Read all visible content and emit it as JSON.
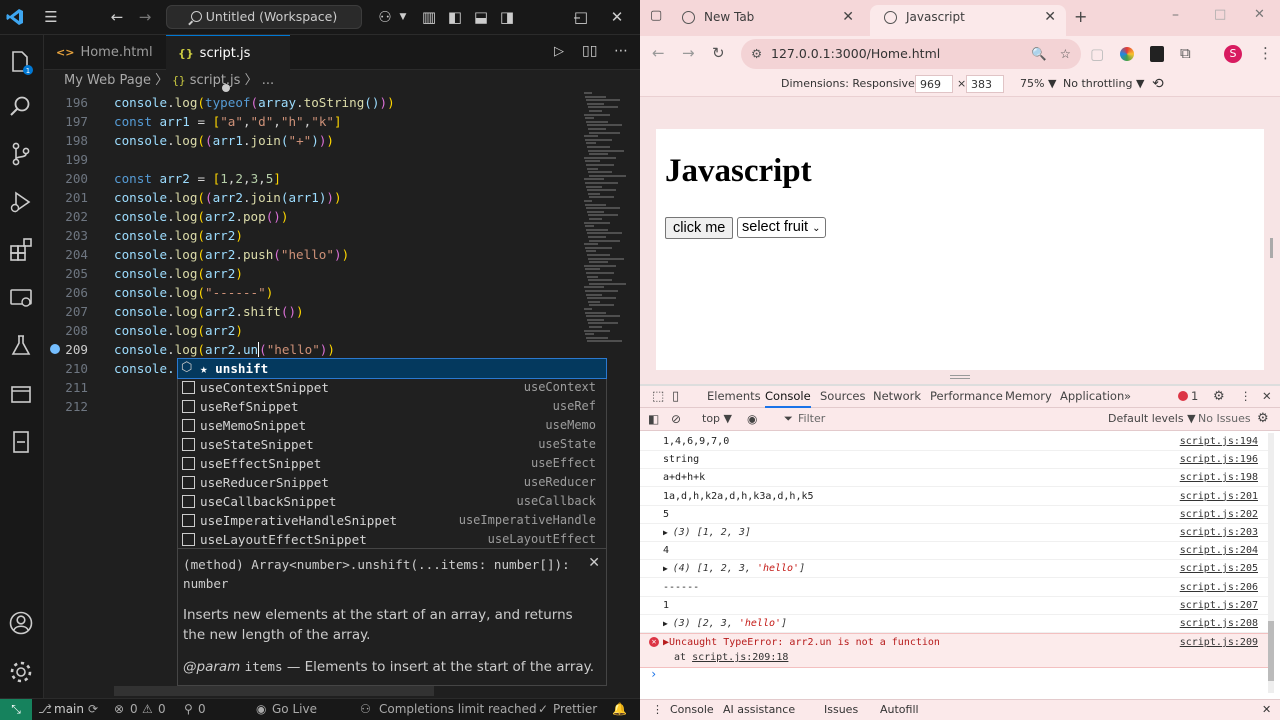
{
  "vscode": {
    "search_title": "Untitled (Workspace)",
    "tabs": [
      {
        "icon": "<>",
        "label": "Home.html"
      },
      {
        "icon": "{}",
        "label": "script.js"
      }
    ],
    "breadcrumb": {
      "folder": "My Web Page",
      "sep1": "〉",
      "file": "script.js",
      "sep2": "〉",
      "more": "..."
    },
    "lines": [
      {
        "n": "196"
      },
      {
        "n": "197"
      },
      {
        "n": "198"
      },
      {
        "n": "199"
      },
      {
        "n": "200"
      },
      {
        "n": "201"
      },
      {
        "n": "202"
      },
      {
        "n": "203"
      },
      {
        "n": "204"
      },
      {
        "n": "205"
      },
      {
        "n": "206"
      },
      {
        "n": "207"
      },
      {
        "n": "208"
      },
      {
        "n": "209"
      },
      {
        "n": "210"
      },
      {
        "n": "211"
      },
      {
        "n": "212"
      }
    ],
    "code_tokens": {
      "console": "console",
      "log": "log",
      "typeof": "typeof",
      "array": "array",
      "toString": "toString",
      "const": "const",
      "arr1": "arr1",
      "arr2": "arr2",
      "join": "join",
      "pop": "pop",
      "push": "push",
      "shift": "shift",
      "un": "un",
      "a": "\"a\"",
      "d": "\"d\"",
      "h": "\"h\"",
      "k": "\"k\"",
      "plus": "\"+\"",
      "hello": "\"hello\"",
      "dashes": "\"------\"",
      "n1": "1",
      "n2": "2",
      "n3": "3",
      "n5": "5",
      "console_partial": "console."
    },
    "suggestions": [
      {
        "label": "★ unshift",
        "detail": ""
      },
      {
        "label": "useContextSnippet",
        "detail": "useContext"
      },
      {
        "label": "useRefSnippet",
        "detail": "useRef"
      },
      {
        "label": "useMemoSnippet",
        "detail": "useMemo"
      },
      {
        "label": "useStateSnippet",
        "detail": "useState"
      },
      {
        "label": "useEffectSnippet",
        "detail": "useEffect"
      },
      {
        "label": "useReducerSnippet",
        "detail": "useReducer"
      },
      {
        "label": "useCallbackSnippet",
        "detail": "useCallback"
      },
      {
        "label": "useImperativeHandleSnippet",
        "detail": "useImperativeHandle"
      },
      {
        "label": "useLayoutEffectSnippet",
        "detail": "useLayoutEffect"
      }
    ],
    "details": {
      "signature": "(method) Array<number>.unshift(...items: number[]): number",
      "description": "Inserts new elements at the start of an array, and returns the new length of the array.",
      "param_tag": "@param",
      "param_name": "items",
      "param_desc": "— Elements to insert at the start of the array."
    },
    "status": {
      "branch": "main",
      "errors": "0",
      "warnings": "0",
      "ports": "0",
      "go_live": "Go Live",
      "completions": "Completions limit reached",
      "prettier": "Prettier"
    },
    "accent": "#0078d4"
  },
  "chrome": {
    "tabs": [
      {
        "label": "New Tab"
      },
      {
        "label": "Javascript"
      }
    ],
    "url": "127.0.0.1:3000/Home.html",
    "profile_initial": "S",
    "devbar": {
      "dimensions": "Dimensions: Responsive ▼",
      "width": "969",
      "times": "×",
      "height": "383",
      "zoom": "75% ▼",
      "throttle": "No throttling ▼"
    },
    "page": {
      "heading": "Javascript",
      "button": "click me",
      "select": "select fruit"
    },
    "devtools_tabs": [
      "Elements",
      "Console",
      "Sources",
      "Network",
      "Performance",
      "Memory",
      "Application"
    ],
    "error_count": "1",
    "filter": {
      "context": "top ▼",
      "placeholder": "Filter",
      "levels": "Default levels ▼",
      "issues": "No Issues"
    },
    "console_lines": [
      {
        "msg": "1,4,6,9,7,0",
        "src": "script.js:194"
      },
      {
        "msg": "string",
        "src": "script.js:196"
      },
      {
        "msg": "a+d+h+k",
        "src": "script.js:198"
      },
      {
        "msg": "1a,d,h,k2a,d,h,k3a,d,h,k5",
        "src": "script.js:201"
      },
      {
        "msg": "5",
        "src": "script.js:202"
      },
      {
        "msg": "▶ (3) [1, 2, 3]",
        "src": "script.js:203"
      },
      {
        "msg": "4",
        "src": "script.js:204"
      },
      {
        "msg": "▶ (4) [1, 2, 3, 'hello']",
        "src": "script.js:205"
      },
      {
        "msg": "------",
        "src": "script.js:206"
      },
      {
        "msg": "1",
        "src": "script.js:207"
      },
      {
        "msg": "▶ (3) [2, 3, 'hello']",
        "src": "script.js:208"
      }
    ],
    "error": {
      "msg": "▶Uncaught TypeError: arr2.un is not a function",
      "at": "at",
      "loc": "script.js:209:18",
      "src": "script.js:209"
    },
    "prompt": "›",
    "drawer": [
      "Console",
      "AI assistance",
      "Issues",
      "Autofill"
    ]
  }
}
